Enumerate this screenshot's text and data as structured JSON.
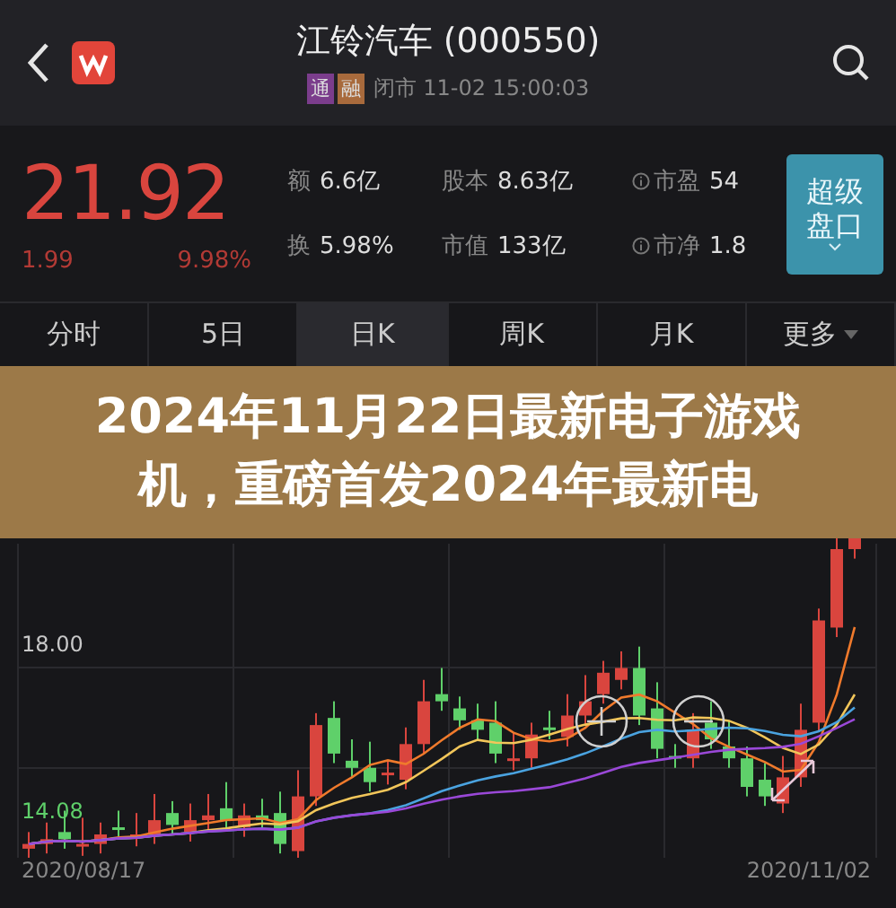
{
  "header": {
    "title": "江铃汽车 (000550)",
    "badges": [
      {
        "label": "通",
        "color": "#7b3d8c"
      },
      {
        "label": "融",
        "color": "#a86a3c"
      }
    ],
    "status": "闭市 11-02 15:00:03"
  },
  "quote": {
    "price": "21.92",
    "change": "1.99",
    "change_pct": "9.98%",
    "stats": [
      {
        "label": "额",
        "value": "6.6亿",
        "info": false
      },
      {
        "label": "股本",
        "value": "8.63亿",
        "info": false
      },
      {
        "label": "市盈",
        "value": "54",
        "info": true
      },
      {
        "label": "换",
        "value": "5.98%",
        "info": false
      },
      {
        "label": "市值",
        "value": "133亿",
        "info": false
      },
      {
        "label": "市净",
        "value": "1.8",
        "info": true
      }
    ],
    "button": "超级盘口"
  },
  "tabs": [
    {
      "label": "分时",
      "selected": false,
      "dropdown": false
    },
    {
      "label": "5日",
      "selected": false,
      "dropdown": false
    },
    {
      "label": "日K",
      "selected": true,
      "dropdown": false
    },
    {
      "label": "周K",
      "selected": false,
      "dropdown": false
    },
    {
      "label": "月K",
      "selected": false,
      "dropdown": false
    },
    {
      "label": "更多",
      "selected": false,
      "dropdown": true
    }
  ],
  "banner": {
    "title": "2024年11月22日最新电子游戏机，重磅首发2024年最新电"
  },
  "chart": {
    "price_labels": [
      {
        "label": "18.00",
        "kind": "neutral"
      },
      {
        "label": "14.08",
        "kind": "low"
      }
    ],
    "dates": [
      "2020/08/17",
      "2020/11/02"
    ]
  }
}
